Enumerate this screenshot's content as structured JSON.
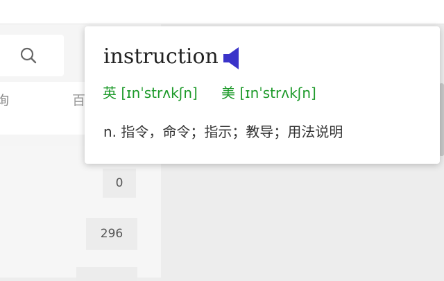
{
  "tabs": [
    "询",
    "百"
  ],
  "counts": [
    "0",
    "296",
    ""
  ],
  "popup": {
    "word": "instruction",
    "phonetic_uk": "英 [ɪnˈstrʌkʃn]",
    "phonetic_us": "美 [ɪnˈstrʌkʃn]",
    "definition": "n. 指令，命令；指示；教导；用法说明"
  },
  "colors": {
    "phonetic": "#1d9a2a",
    "speaker": "#3a33c9"
  },
  "icons": {
    "search": "search-icon",
    "speaker": "speaker-icon"
  }
}
